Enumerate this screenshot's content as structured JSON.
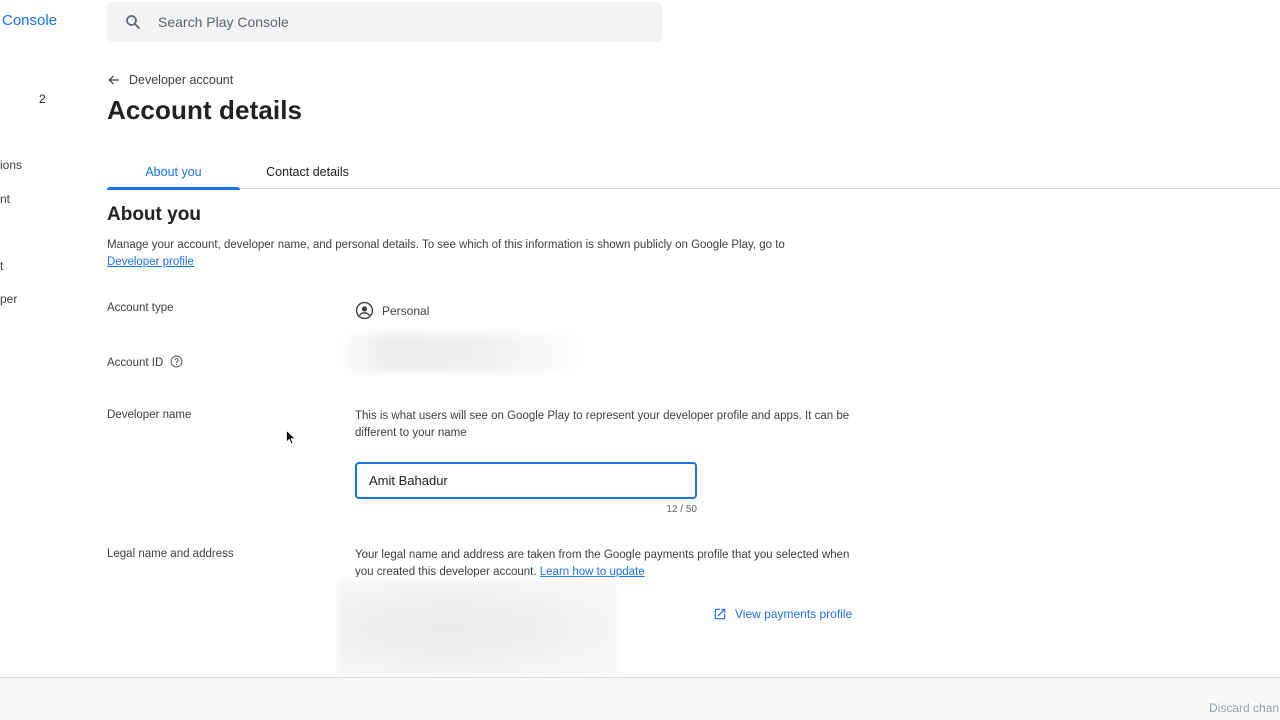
{
  "sidebar": {
    "brand": "Console",
    "count": "2",
    "fragments": [
      "ions",
      "nt",
      "t",
      "per"
    ]
  },
  "search": {
    "placeholder": "Search Play Console"
  },
  "breadcrumb": {
    "label": "Developer account"
  },
  "page": {
    "title": "Account details"
  },
  "tabs": [
    {
      "label": "About you",
      "active": true
    },
    {
      "label": "Contact details",
      "active": false
    }
  ],
  "section": {
    "title": "About you",
    "description": "Manage your account, developer name, and personal details. To see which of this information is shown publicly on Google Play, go to",
    "link": "Developer profile"
  },
  "fields": {
    "account_type": {
      "label": "Account type",
      "value": "Personal",
      "icon": "account-circle-icon"
    },
    "account_id": {
      "label": "Account ID",
      "icon": "help-icon"
    },
    "developer_name": {
      "label": "Developer name",
      "help": "This is what users will see on Google Play to represent your developer profile and apps. It can be different to your name",
      "value": "Amit Bahadur",
      "counter": "12 / 50"
    },
    "legal": {
      "label": "Legal name and address",
      "help": "Your legal name and address are taken from the Google payments profile that you selected when you created this developer account.",
      "link": "Learn how to update",
      "payments_link": "View payments profile"
    }
  },
  "footer": {
    "discard": "Discard chan"
  },
  "colors": {
    "accent": "#1a73e8",
    "text": "#202124",
    "divider": "#dadce0"
  }
}
